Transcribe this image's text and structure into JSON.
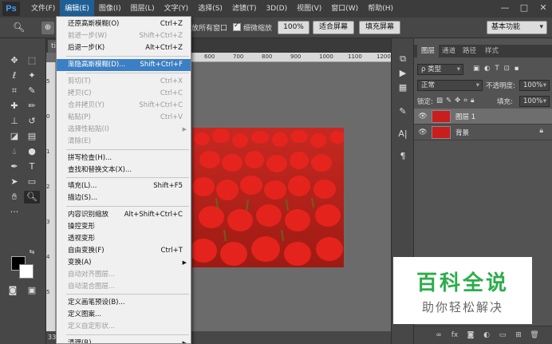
{
  "app": {
    "logo": "Ps"
  },
  "menubar": {
    "items": [
      "文件(F)",
      "编辑(E)",
      "图像(I)",
      "图层(L)",
      "文字(Y)",
      "选择(S)",
      "滤镜(T)",
      "3D(D)",
      "视图(V)",
      "窗口(W)",
      "帮助(H)"
    ],
    "active_index": 1
  },
  "window_controls": {
    "minimize": "—",
    "maximize": "□",
    "close": "✕"
  },
  "options": {
    "all_windows_label": "放所有窗口",
    "scrubby_zoom_label": "细微缩放",
    "zoom_value": "100%",
    "fit_screen": "适合屏幕",
    "fill_screen": "填充屏幕",
    "workspace": "基本功能"
  },
  "document": {
    "tab_label": "ti",
    "ruler_top": [
      "600",
      "700",
      "800",
      "900",
      "1000",
      "1100",
      "1200",
      "1300"
    ],
    "ruler_left": [
      "5",
      "0",
      "1",
      "2",
      "3",
      "4",
      "5"
    ],
    "status": "33."
  },
  "edit_menu": {
    "items": [
      {
        "label": "还原高斯模糊(O)",
        "shortcut": "Ctrl+Z",
        "disabled": false
      },
      {
        "label": "前进一步(W)",
        "shortcut": "Shift+Ctrl+Z",
        "disabled": true
      },
      {
        "label": "后退一步(K)",
        "shortcut": "Alt+Ctrl+Z",
        "disabled": false
      },
      {
        "label": "渐隐高斯模糊(D)...",
        "shortcut": "Shift+Ctrl+F",
        "disabled": false,
        "highlight": true
      },
      {
        "label": "剪切(T)",
        "shortcut": "Ctrl+X",
        "disabled": true
      },
      {
        "label": "拷贝(C)",
        "shortcut": "Ctrl+C",
        "disabled": true
      },
      {
        "label": "合并拷贝(Y)",
        "shortcut": "Shift+Ctrl+C",
        "disabled": true
      },
      {
        "label": "粘贴(P)",
        "shortcut": "Ctrl+V",
        "disabled": true
      },
      {
        "label": "选择性粘贴(I)",
        "shortcut": "",
        "disabled": true,
        "submenu": true
      },
      {
        "label": "清除(E)",
        "shortcut": "",
        "disabled": true
      },
      {
        "label": "拼写检查(H)...",
        "shortcut": "",
        "disabled": false
      },
      {
        "label": "查找和替换文本(X)...",
        "shortcut": "",
        "disabled": false
      },
      {
        "label": "填充(L)...",
        "shortcut": "Shift+F5",
        "disabled": false
      },
      {
        "label": "描边(S)...",
        "shortcut": "",
        "disabled": false
      },
      {
        "label": "内容识别缩放",
        "shortcut": "Alt+Shift+Ctrl+C",
        "disabled": false
      },
      {
        "label": "操控变形",
        "shortcut": "",
        "disabled": false
      },
      {
        "label": "透视变形",
        "shortcut": "",
        "disabled": false
      },
      {
        "label": "自由变换(F)",
        "shortcut": "Ctrl+T",
        "disabled": false
      },
      {
        "label": "变换(A)",
        "shortcut": "",
        "disabled": false,
        "submenu": true
      },
      {
        "label": "自动对齐图层...",
        "shortcut": "",
        "disabled": true
      },
      {
        "label": "自动混合图层...",
        "shortcut": "",
        "disabled": true
      },
      {
        "label": "定义画笔预设(B)...",
        "shortcut": "",
        "disabled": false
      },
      {
        "label": "定义图案...",
        "shortcut": "",
        "disabled": false
      },
      {
        "label": "定义自定形状...",
        "shortcut": "",
        "disabled": true
      },
      {
        "label": "清理(R)",
        "shortcut": "",
        "disabled": false,
        "submenu": true
      }
    ]
  },
  "layers_panel": {
    "tabs": [
      "图层",
      "通道",
      "路径",
      "样式"
    ],
    "active_tab": 0,
    "filter_label": "ρ 类型",
    "blend_mode": "正常",
    "opacity_label": "不透明度:",
    "opacity_value": "100%",
    "lock_label": "锁定:",
    "fill_label": "填充:",
    "fill_value": "100%",
    "layers": [
      {
        "name": "图层 1",
        "selected": true,
        "locked": false
      },
      {
        "name": "背景",
        "selected": false,
        "locked": true
      }
    ]
  },
  "watermark": {
    "title": "百科全说",
    "subtitle": "助你轻松解决"
  }
}
